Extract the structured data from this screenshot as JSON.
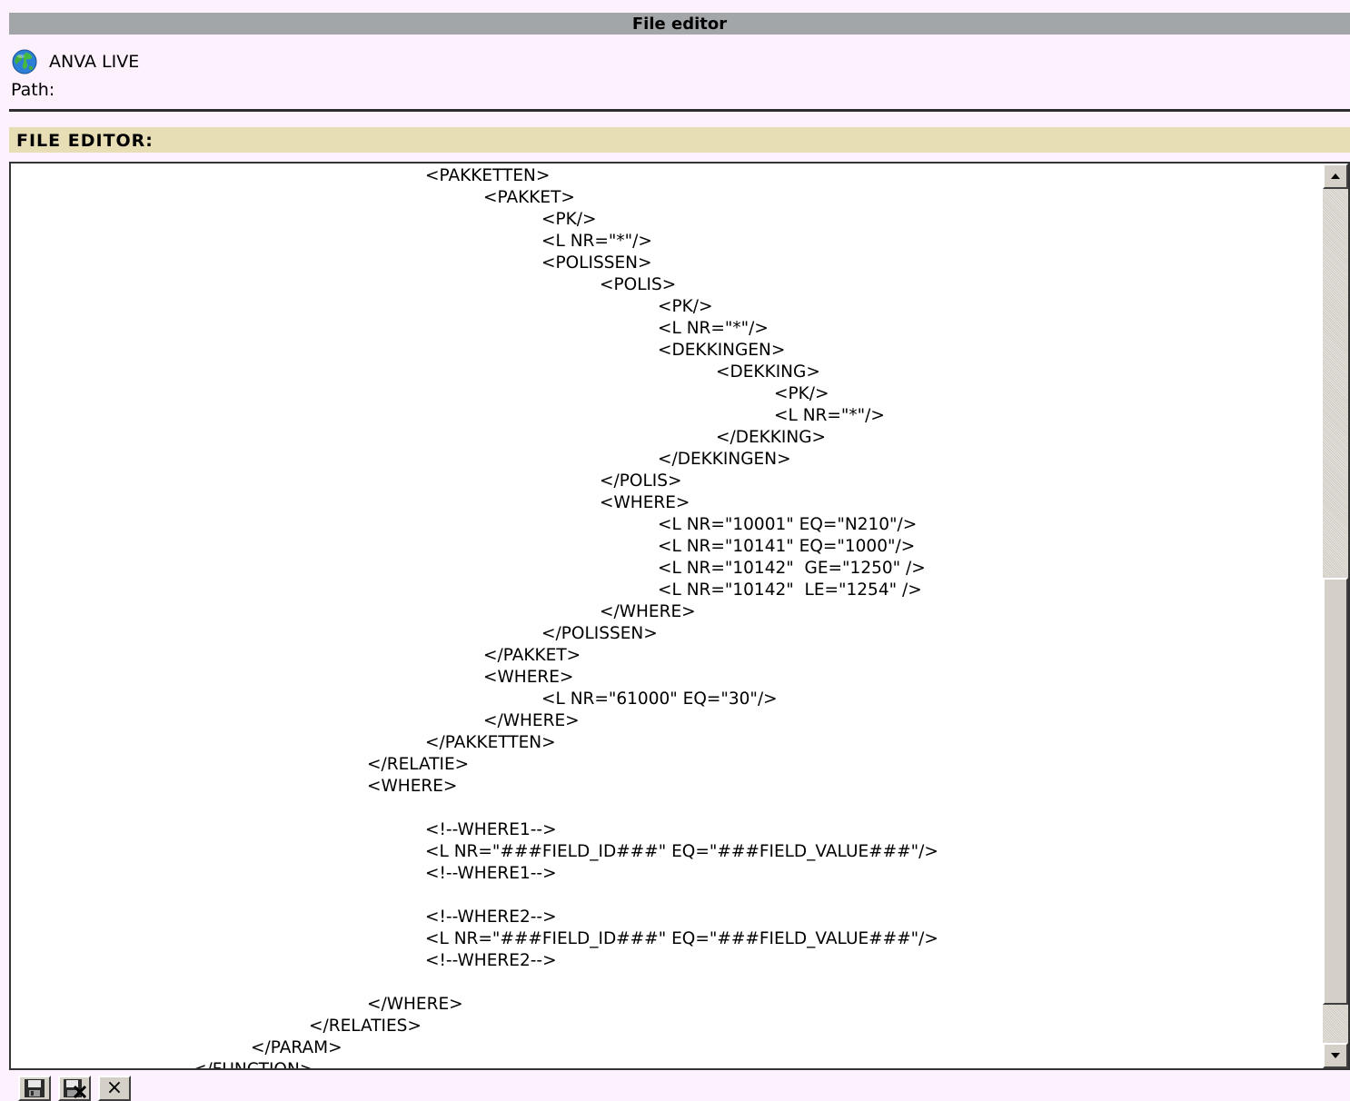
{
  "window": {
    "title": "File editor"
  },
  "site": {
    "name": "ANVA LIVE",
    "icon": "globe-icon",
    "path_label": "Path:"
  },
  "section": {
    "heading": "FILE EDITOR:"
  },
  "editor": {
    "lines": [
      {
        "indent": 7,
        "text": "<PAKKETTEN>"
      },
      {
        "indent": 8,
        "text": "<PAKKET>"
      },
      {
        "indent": 9,
        "text": "<PK/>"
      },
      {
        "indent": 9,
        "text": "<L NR=\"*\"/>"
      },
      {
        "indent": 9,
        "text": "<POLISSEN>"
      },
      {
        "indent": 10,
        "text": "<POLIS>"
      },
      {
        "indent": 11,
        "text": "<PK/>"
      },
      {
        "indent": 11,
        "text": "<L NR=\"*\"/>"
      },
      {
        "indent": 11,
        "text": "<DEKKINGEN>"
      },
      {
        "indent": 12,
        "text": "<DEKKING>"
      },
      {
        "indent": 13,
        "text": "<PK/>"
      },
      {
        "indent": 13,
        "text": "<L NR=\"*\"/>"
      },
      {
        "indent": 12,
        "text": "</DEKKING>"
      },
      {
        "indent": 11,
        "text": "</DEKKINGEN>"
      },
      {
        "indent": 10,
        "text": "</POLIS>"
      },
      {
        "indent": 10,
        "text": "<WHERE>"
      },
      {
        "indent": 11,
        "text": "<L NR=\"10001\" EQ=\"N210\"/>"
      },
      {
        "indent": 11,
        "text": "<L NR=\"10141\" EQ=\"1000\"/>"
      },
      {
        "indent": 11,
        "text": "<L NR=\"10142\"  GE=\"1250\" />"
      },
      {
        "indent": 11,
        "text": "<L NR=\"10142\"  LE=\"1254\" />"
      },
      {
        "indent": 10,
        "text": "</WHERE>"
      },
      {
        "indent": 9,
        "text": "</POLISSEN>"
      },
      {
        "indent": 8,
        "text": "</PAKKET>"
      },
      {
        "indent": 8,
        "text": "<WHERE>"
      },
      {
        "indent": 9,
        "text": "<L NR=\"61000\" EQ=\"30\"/>"
      },
      {
        "indent": 8,
        "text": "</WHERE>"
      },
      {
        "indent": 7,
        "text": "</PAKKETTEN>"
      },
      {
        "indent": 6,
        "text": "</RELATIE>"
      },
      {
        "indent": 6,
        "text": "<WHERE>"
      },
      {
        "indent": 0,
        "text": ""
      },
      {
        "indent": 7,
        "text": "<!--WHERE1-->"
      },
      {
        "indent": 7,
        "text": "<L NR=\"###FIELD_ID###\" EQ=\"###FIELD_VALUE###\"/>"
      },
      {
        "indent": 7,
        "text": "<!--WHERE1-->"
      },
      {
        "indent": 0,
        "text": ""
      },
      {
        "indent": 7,
        "text": "<!--WHERE2-->"
      },
      {
        "indent": 7,
        "text": "<L NR=\"###FIELD_ID###\" EQ=\"###FIELD_VALUE###\"/>"
      },
      {
        "indent": 7,
        "text": "<!--WHERE2-->"
      },
      {
        "indent": 0,
        "text": ""
      },
      {
        "indent": 6,
        "text": "</WHERE>"
      },
      {
        "indent": 5,
        "text": "</RELATIES>"
      },
      {
        "indent": 4,
        "text": "</PARAM>"
      },
      {
        "indent": 3,
        "text": "</FUNCTION>"
      }
    ]
  },
  "toolbar": {
    "buttons": [
      {
        "name": "save-button",
        "icon": "floppy-disk-icon"
      },
      {
        "name": "save-and-close-button",
        "icon": "floppy-disk-close-icon"
      },
      {
        "name": "close-button",
        "icon": "close-icon",
        "glyph": "×"
      }
    ]
  }
}
